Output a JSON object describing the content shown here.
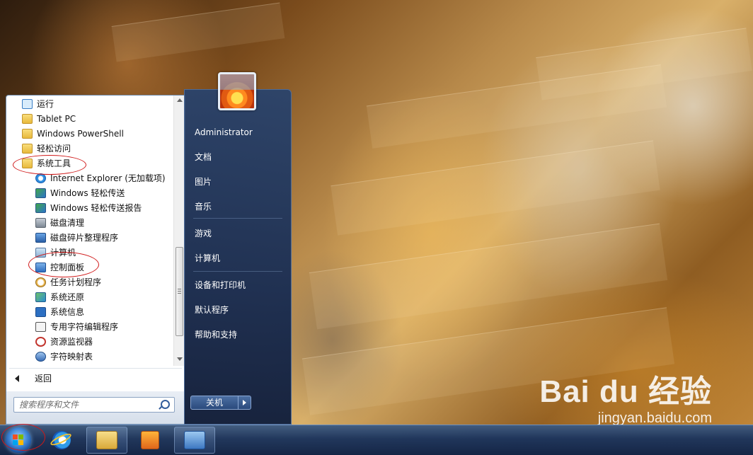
{
  "menu": {
    "programs": [
      {
        "label": "运行",
        "icon": "run-icon"
      },
      {
        "label": "Tablet PC",
        "icon": "folder-icon"
      },
      {
        "label": "Windows PowerShell",
        "icon": "folder-icon"
      },
      {
        "label": "轻松访问",
        "icon": "folder-icon"
      },
      {
        "label": "系统工具",
        "icon": "folder-icon"
      },
      {
        "label": "Internet Explorer (无加载项)",
        "icon": "ie-icon"
      },
      {
        "label": "Windows 轻松传送",
        "icon": "easy-transfer-icon"
      },
      {
        "label": "Windows 轻松传送报告",
        "icon": "easy-transfer-report-icon"
      },
      {
        "label": "磁盘清理",
        "icon": "disk-cleanup-icon"
      },
      {
        "label": "磁盘碎片整理程序",
        "icon": "defrag-icon"
      },
      {
        "label": "计算机",
        "icon": "computer-icon"
      },
      {
        "label": "控制面板",
        "icon": "control-panel-icon"
      },
      {
        "label": "任务计划程序",
        "icon": "task-scheduler-icon"
      },
      {
        "label": "系统还原",
        "icon": "system-restore-icon"
      },
      {
        "label": "系统信息",
        "icon": "system-info-icon"
      },
      {
        "label": "专用字符编辑程序",
        "icon": "char-editor-icon"
      },
      {
        "label": "资源监视器",
        "icon": "resource-monitor-icon"
      },
      {
        "label": "字符映射表",
        "icon": "char-map-icon"
      }
    ],
    "back_label": "返回",
    "search_placeholder": "搜索程序和文件",
    "right": {
      "user": "Administrator",
      "items": [
        "文档",
        "图片",
        "音乐",
        "游戏",
        "计算机",
        "设备和打印机",
        "默认程序",
        "帮助和支持"
      ]
    },
    "shutdown_label": "关机"
  },
  "watermark": {
    "logo": "Bai du 经验",
    "url": "jingyan.baidu.com"
  },
  "colors": {
    "annotation": "#d01818",
    "right_pane": "#26426e"
  }
}
